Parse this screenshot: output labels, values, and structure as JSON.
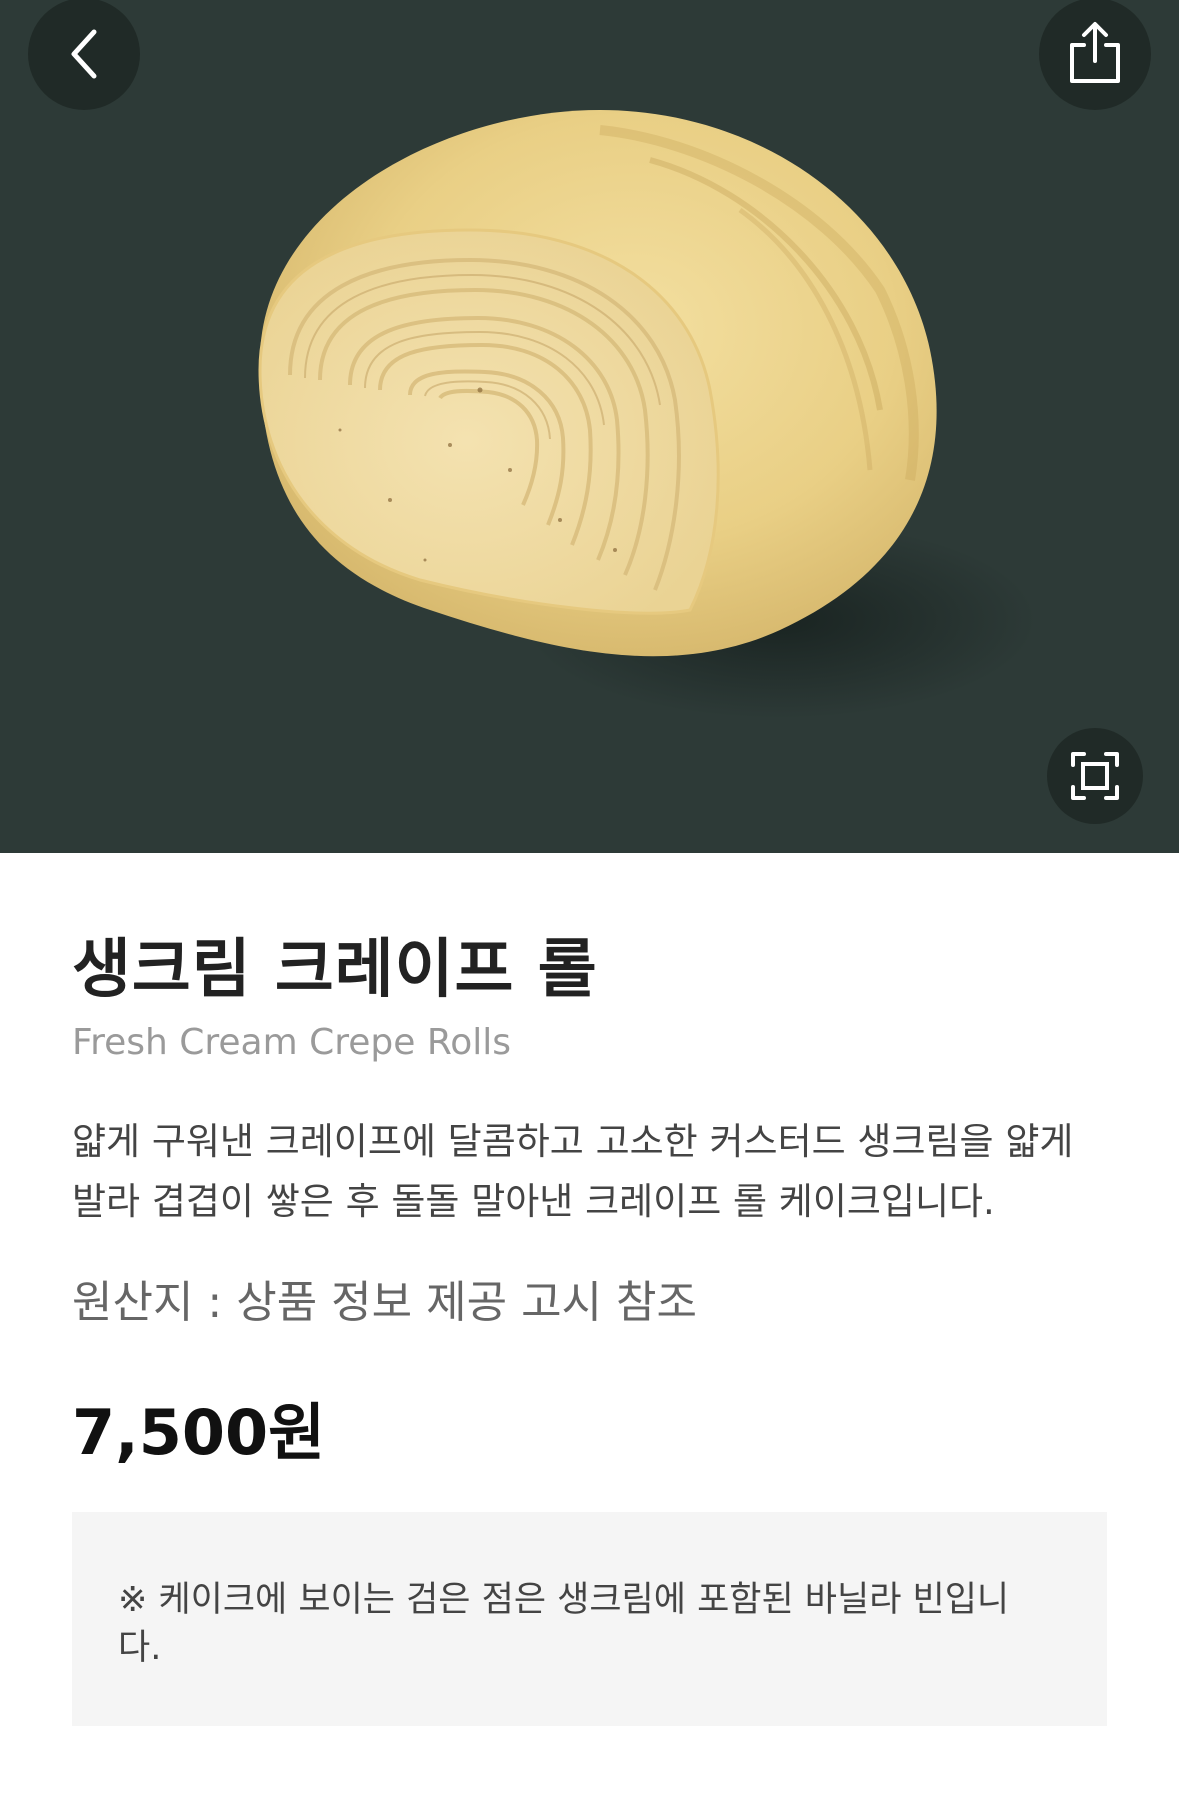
{
  "header": {
    "back_icon": "chevron-left-icon",
    "share_icon": "share-icon",
    "expand_icon": "expand-frame-icon"
  },
  "product": {
    "name_ko": "생크림 크레이프 롤",
    "name_en": "Fresh Cream Crepe Rolls",
    "description": "얇게 구워낸 크레이프에 달콤하고 고소한 커스터드 생크림을 얇게 발라 겹겹이 쌓은 후 돌돌 말아낸 크레이프 롤 케이크입니다.",
    "origin": "원산지 : 상품 정보 제공 고시 참조",
    "price": "7,500원",
    "notice": "※ 케이크에 보이는 검은 점은 생크림에 포함된 바닐라 빈입니다."
  },
  "colors": {
    "hero_background": "#2d3a37",
    "title": "#222222",
    "subtitle": "#9a9a9a",
    "notice_background": "#f5f5f5"
  }
}
